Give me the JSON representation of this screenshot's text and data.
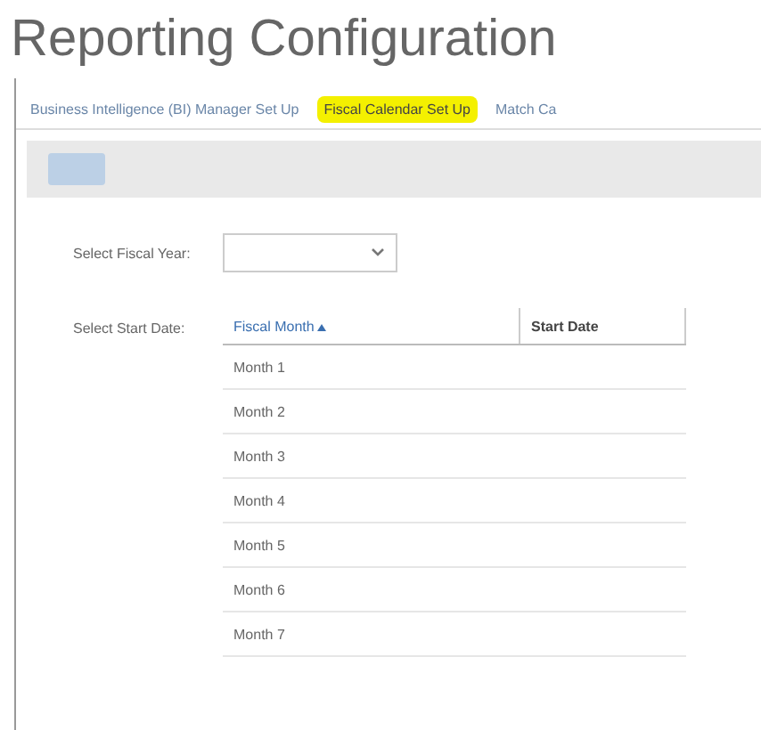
{
  "title": "Reporting Configuration",
  "tabs": [
    {
      "label": "Business Intelligence (BI) Manager Set Up",
      "selected": false
    },
    {
      "label": "Fiscal Calendar Set Up",
      "selected": true
    },
    {
      "label": "Match Ca",
      "selected": false
    }
  ],
  "fiscal_year": {
    "label": "Select Fiscal Year:"
  },
  "start_date": {
    "label": "Select Start Date:"
  },
  "table": {
    "columns": [
      {
        "label": "Fiscal Month",
        "sorted": true
      },
      {
        "label": "Start Date",
        "sorted": false
      }
    ],
    "rows": [
      [
        "Month 1"
      ],
      [
        "Month 2"
      ],
      [
        "Month 3"
      ],
      [
        "Month 4"
      ],
      [
        "Month 5"
      ],
      [
        "Month 6"
      ],
      [
        "Month 7"
      ]
    ]
  }
}
